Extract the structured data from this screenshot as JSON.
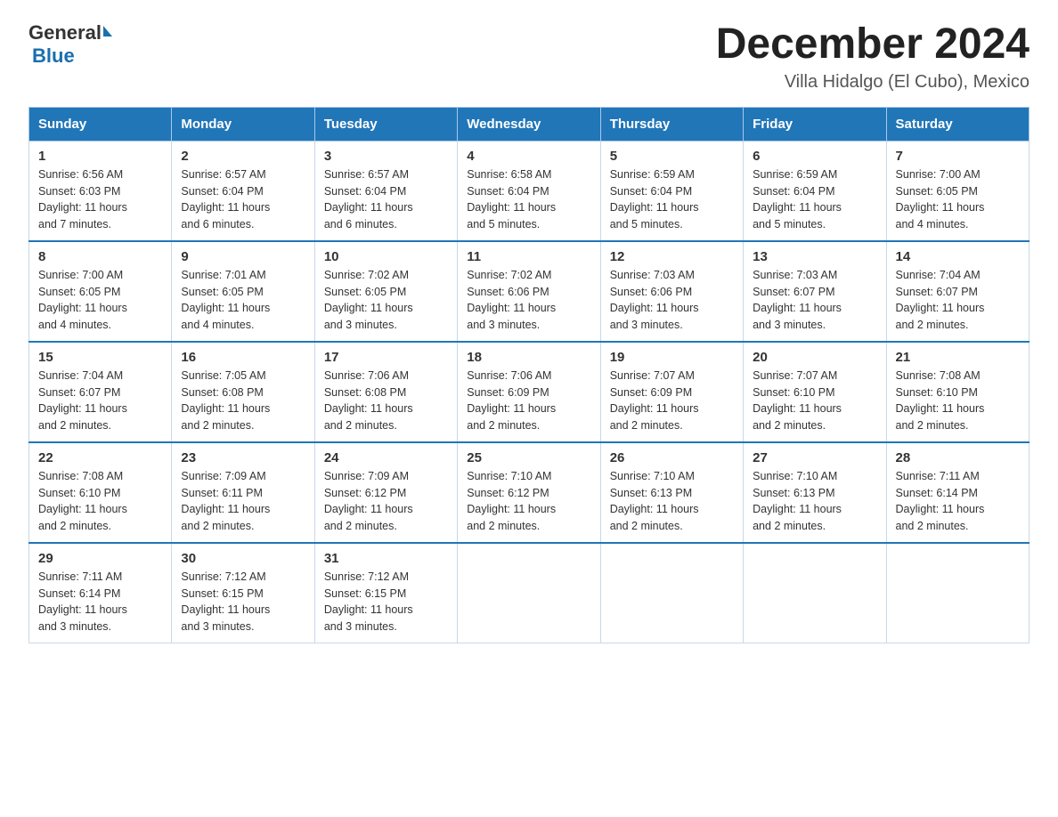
{
  "header": {
    "logo_general": "General",
    "logo_blue": "Blue",
    "title": "December 2024",
    "subtitle": "Villa Hidalgo (El Cubo), Mexico"
  },
  "days_of_week": [
    "Sunday",
    "Monday",
    "Tuesday",
    "Wednesday",
    "Thursday",
    "Friday",
    "Saturday"
  ],
  "weeks": [
    [
      {
        "day": "1",
        "sunrise": "6:56 AM",
        "sunset": "6:03 PM",
        "daylight": "11 hours and 7 minutes."
      },
      {
        "day": "2",
        "sunrise": "6:57 AM",
        "sunset": "6:04 PM",
        "daylight": "11 hours and 6 minutes."
      },
      {
        "day": "3",
        "sunrise": "6:57 AM",
        "sunset": "6:04 PM",
        "daylight": "11 hours and 6 minutes."
      },
      {
        "day": "4",
        "sunrise": "6:58 AM",
        "sunset": "6:04 PM",
        "daylight": "11 hours and 5 minutes."
      },
      {
        "day": "5",
        "sunrise": "6:59 AM",
        "sunset": "6:04 PM",
        "daylight": "11 hours and 5 minutes."
      },
      {
        "day": "6",
        "sunrise": "6:59 AM",
        "sunset": "6:04 PM",
        "daylight": "11 hours and 5 minutes."
      },
      {
        "day": "7",
        "sunrise": "7:00 AM",
        "sunset": "6:05 PM",
        "daylight": "11 hours and 4 minutes."
      }
    ],
    [
      {
        "day": "8",
        "sunrise": "7:00 AM",
        "sunset": "6:05 PM",
        "daylight": "11 hours and 4 minutes."
      },
      {
        "day": "9",
        "sunrise": "7:01 AM",
        "sunset": "6:05 PM",
        "daylight": "11 hours and 4 minutes."
      },
      {
        "day": "10",
        "sunrise": "7:02 AM",
        "sunset": "6:05 PM",
        "daylight": "11 hours and 3 minutes."
      },
      {
        "day": "11",
        "sunrise": "7:02 AM",
        "sunset": "6:06 PM",
        "daylight": "11 hours and 3 minutes."
      },
      {
        "day": "12",
        "sunrise": "7:03 AM",
        "sunset": "6:06 PM",
        "daylight": "11 hours and 3 minutes."
      },
      {
        "day": "13",
        "sunrise": "7:03 AM",
        "sunset": "6:07 PM",
        "daylight": "11 hours and 3 minutes."
      },
      {
        "day": "14",
        "sunrise": "7:04 AM",
        "sunset": "6:07 PM",
        "daylight": "11 hours and 2 minutes."
      }
    ],
    [
      {
        "day": "15",
        "sunrise": "7:04 AM",
        "sunset": "6:07 PM",
        "daylight": "11 hours and 2 minutes."
      },
      {
        "day": "16",
        "sunrise": "7:05 AM",
        "sunset": "6:08 PM",
        "daylight": "11 hours and 2 minutes."
      },
      {
        "day": "17",
        "sunrise": "7:06 AM",
        "sunset": "6:08 PM",
        "daylight": "11 hours and 2 minutes."
      },
      {
        "day": "18",
        "sunrise": "7:06 AM",
        "sunset": "6:09 PM",
        "daylight": "11 hours and 2 minutes."
      },
      {
        "day": "19",
        "sunrise": "7:07 AM",
        "sunset": "6:09 PM",
        "daylight": "11 hours and 2 minutes."
      },
      {
        "day": "20",
        "sunrise": "7:07 AM",
        "sunset": "6:10 PM",
        "daylight": "11 hours and 2 minutes."
      },
      {
        "day": "21",
        "sunrise": "7:08 AM",
        "sunset": "6:10 PM",
        "daylight": "11 hours and 2 minutes."
      }
    ],
    [
      {
        "day": "22",
        "sunrise": "7:08 AM",
        "sunset": "6:10 PM",
        "daylight": "11 hours and 2 minutes."
      },
      {
        "day": "23",
        "sunrise": "7:09 AM",
        "sunset": "6:11 PM",
        "daylight": "11 hours and 2 minutes."
      },
      {
        "day": "24",
        "sunrise": "7:09 AM",
        "sunset": "6:12 PM",
        "daylight": "11 hours and 2 minutes."
      },
      {
        "day": "25",
        "sunrise": "7:10 AM",
        "sunset": "6:12 PM",
        "daylight": "11 hours and 2 minutes."
      },
      {
        "day": "26",
        "sunrise": "7:10 AM",
        "sunset": "6:13 PM",
        "daylight": "11 hours and 2 minutes."
      },
      {
        "day": "27",
        "sunrise": "7:10 AM",
        "sunset": "6:13 PM",
        "daylight": "11 hours and 2 minutes."
      },
      {
        "day": "28",
        "sunrise": "7:11 AM",
        "sunset": "6:14 PM",
        "daylight": "11 hours and 2 minutes."
      }
    ],
    [
      {
        "day": "29",
        "sunrise": "7:11 AM",
        "sunset": "6:14 PM",
        "daylight": "11 hours and 3 minutes."
      },
      {
        "day": "30",
        "sunrise": "7:12 AM",
        "sunset": "6:15 PM",
        "daylight": "11 hours and 3 minutes."
      },
      {
        "day": "31",
        "sunrise": "7:12 AM",
        "sunset": "6:15 PM",
        "daylight": "11 hours and 3 minutes."
      },
      null,
      null,
      null,
      null
    ]
  ],
  "labels": {
    "sunrise": "Sunrise:",
    "sunset": "Sunset:",
    "daylight": "Daylight:"
  }
}
